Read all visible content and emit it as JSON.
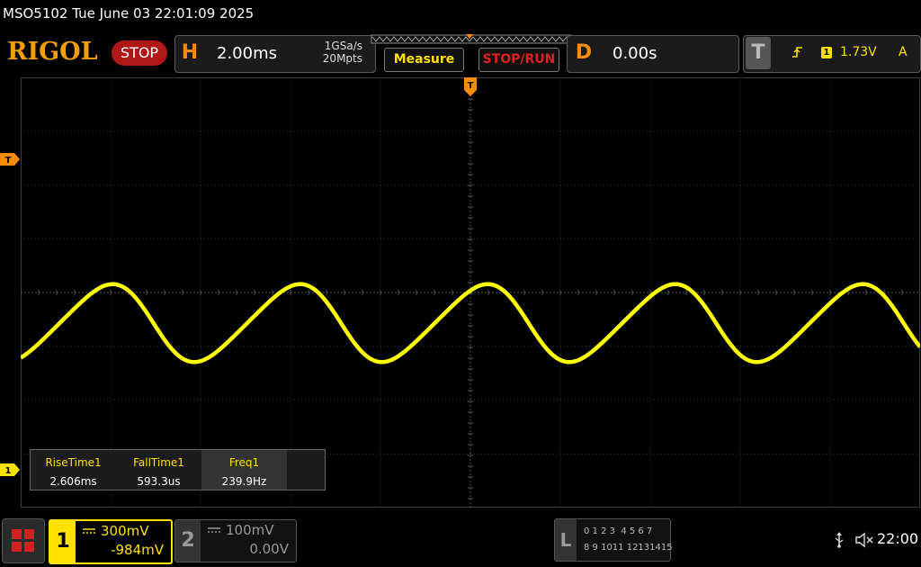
{
  "title": "MSO5102  Tue June 03 22:01:09 2025",
  "logo": "RIGOL",
  "run_state": "STOP",
  "horizontal": {
    "letter": "H",
    "timebase": "2.00ms",
    "sample_rate": "1GSa/s",
    "memory_depth": "20Mpts"
  },
  "buttons": {
    "measure": "Measure",
    "stop_run": "STOP/RUN"
  },
  "delay": {
    "letter": "D",
    "value": "0.00s"
  },
  "trigger": {
    "letter": "T",
    "source": "1",
    "level": "1.73V",
    "mode": "A"
  },
  "markers": {
    "trigger_time": "T",
    "trigger_level": "T",
    "ch1_ground": "1"
  },
  "measurements": [
    {
      "label": "RiseTime1",
      "value": "2.606ms"
    },
    {
      "label": "FallTime1",
      "value": "593.3us"
    },
    {
      "label": "Freq1",
      "value": "239.9Hz"
    }
  ],
  "channels": [
    {
      "number": "1",
      "scale": "300mV",
      "offset": "-984mV",
      "active": true
    },
    {
      "number": "2",
      "scale": "100mV",
      "offset": "0.00V",
      "active": false
    }
  ],
  "logic": {
    "letter": "L",
    "row1": "0 1 2 3  4 5 6 7",
    "row2": "8 9 1011 12131415"
  },
  "status": {
    "time": "22:00"
  },
  "colors": {
    "ch1": "#ffff00",
    "trigger": "#ff8c00",
    "stop": "#b01818",
    "grid": "#3a3a3a"
  },
  "icons": [
    "grid-menu-icon",
    "usb-icon",
    "mute-speaker-icon",
    "trigger-edge-icon",
    "coupling-dc-icon"
  ]
}
